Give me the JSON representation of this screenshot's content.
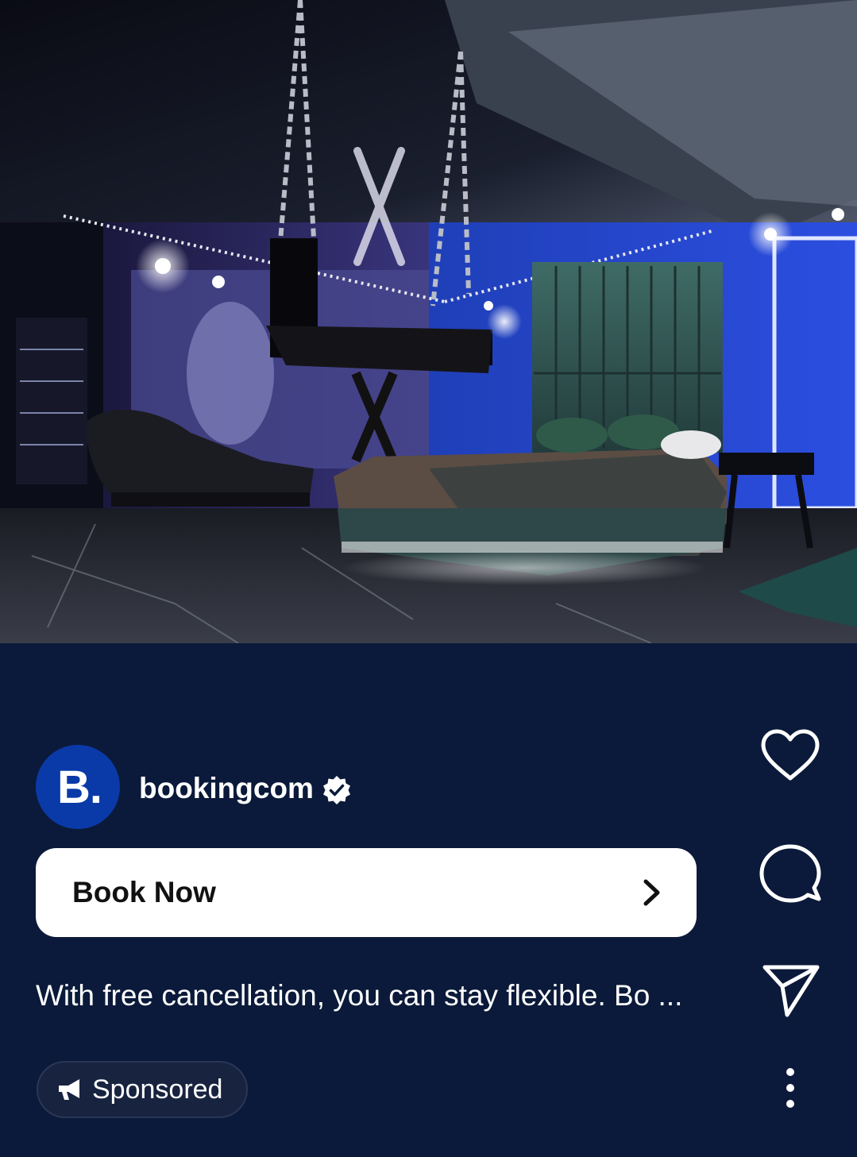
{
  "post": {
    "image_alt_subject": "hotel-room-photo",
    "account": {
      "avatar_text": "B.",
      "username": "bookingcom",
      "verified": true
    },
    "cta": {
      "label": "Book Now"
    },
    "caption": "With free cancellation, you can stay flexible. Bo ...",
    "sponsored_label": "Sponsored"
  },
  "actions": {
    "icons": [
      "heart-icon",
      "comment-icon",
      "send-icon",
      "more-icon"
    ]
  },
  "colors": {
    "background": "#0b1a3a",
    "avatar": "#0a3aa8",
    "button": "#ffffff",
    "text": "#ffffff"
  }
}
